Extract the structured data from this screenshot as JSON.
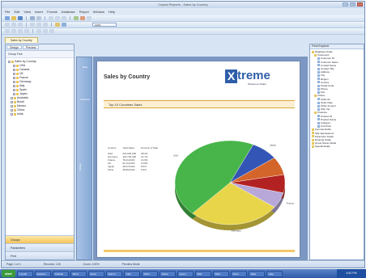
{
  "window": {
    "title": "Crystal Reports - Sales by Country"
  },
  "menu": [
    "File",
    "Edit",
    "View",
    "Insert",
    "Format",
    "Database",
    "Report",
    "Window",
    "Help"
  ],
  "toolbar": {
    "zoom": "100%"
  },
  "doc_tab": "Sales by Country",
  "left_panel": {
    "tabs": [
      "Design",
      "Preview"
    ],
    "title": "Group Tree",
    "tree": [
      "Sales by Country",
      "USA",
      "Canada",
      "UK",
      "France",
      "Germany",
      "Italy",
      "Spain",
      "Japan",
      "Australia",
      "Brazil",
      "Mexico",
      "China",
      "India"
    ],
    "buttons": [
      "Groups",
      "Parameters",
      "Find"
    ]
  },
  "side_strip": {
    "top_label": "Main",
    "mid_label": "Sections",
    "rotated_label": "Details"
  },
  "report": {
    "title": "Sales by Country",
    "logo_word": "treme",
    "logo_mark": "X",
    "logo_subtitle": "Showroom Sales",
    "section_title": "Top 10 Countries Sales",
    "table": {
      "headers": [
        "Country",
        "Total Sales",
        "Percent of Total"
      ],
      "rows": [
        [
          "USA",
          "215,540,000",
          "38.2%"
        ],
        [
          "Germany",
          "122,730,000",
          "21.7%"
        ],
        [
          "France",
          "78,410,000",
          "13.9%"
        ],
        [
          "UK",
          "61,210,000",
          "10.8%"
        ],
        [
          "Japan",
          "48,270,000",
          "8.5%"
        ],
        [
          "Other",
          "38,950,000",
          "6.9%"
        ]
      ]
    }
  },
  "chart_data": {
    "type": "pie",
    "title": "",
    "series": [
      {
        "values": [
          8,
          7,
          7,
          6,
          27,
          45
        ]
      }
    ],
    "categories": [
      "Japan",
      "UK",
      "Other",
      "France",
      "Germany",
      "USA"
    ],
    "slice_labels": [
      "USA",
      "Germany",
      "France",
      "Japan"
    ],
    "colors": [
      "#3355b5",
      "#d4652a",
      "#b22222",
      "#b7a8d9",
      "#e9d54a",
      "#47b54a"
    ]
  },
  "right_panel": {
    "title": "Field Explorer",
    "tree": [
      "Database Fields",
      "Customers",
      "Customer ID",
      "Customer Name",
      "Contact Name",
      "Contact Title",
      "Address",
      "City",
      "Region",
      "Country",
      "Postal Code",
      "Phone",
      "Fax",
      "Orders",
      "Order ID",
      "Order Date",
      "Order Amount",
      "Ship Via",
      "Products",
      "Product ID",
      "Product Name",
      "Category",
      "Unit Price",
      "Formula Fields",
      "SQL Expressions",
      "Parameter Fields",
      "Running Totals",
      "Group Name Fields",
      "Special Fields"
    ]
  },
  "status": {
    "page": "Page 1 of 1",
    "records": "Records: 125",
    "zoom": "Zoom: 100%",
    "view": "Preview Mode"
  },
  "taskbar": {
    "start": "start",
    "items": [
      "Crystal",
      "Explorer",
      "Outlook",
      "Word",
      "Excel",
      "Report",
      "Calc",
      "Paint",
      "Notes",
      "Query",
      "Mail",
      "Web",
      "Docs",
      "Data",
      "Help"
    ],
    "clock": "4:52 PM"
  }
}
